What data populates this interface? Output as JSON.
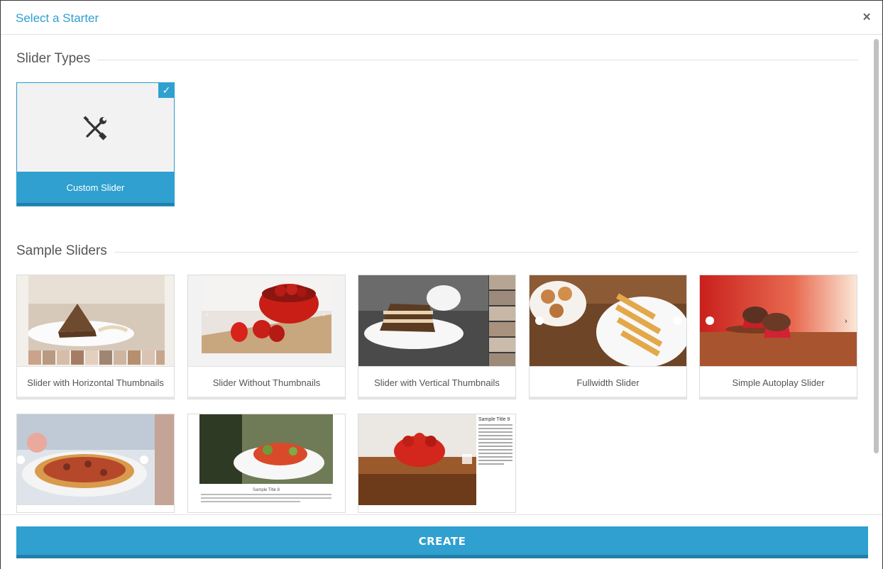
{
  "dialog": {
    "title": "Select a Starter",
    "close_label": "×"
  },
  "slider_types": {
    "heading": "Slider Types",
    "items": [
      {
        "label": "Custom Slider",
        "selected": true,
        "icon": "tools-icon"
      }
    ]
  },
  "sample_sliders": {
    "heading": "Sample Sliders",
    "items": [
      {
        "label": "Slider with Horizontal Thumbnails"
      },
      {
        "label": "Slider Without Thumbnails"
      },
      {
        "label": "Slider with Vertical Thumbnails"
      },
      {
        "label": "Fullwidth Slider"
      },
      {
        "label": "Simple Autoplay Slider"
      },
      {
        "label": ""
      },
      {
        "label": "",
        "thumb_caption": "Sample Title 8"
      },
      {
        "label": "",
        "thumb_caption": "Sample Title 9"
      }
    ]
  },
  "footer": {
    "create_label": "CREATE"
  },
  "colors": {
    "accent": "#2fa0cf",
    "accent_dark": "#237fa8",
    "title": "#2fa0cf"
  }
}
